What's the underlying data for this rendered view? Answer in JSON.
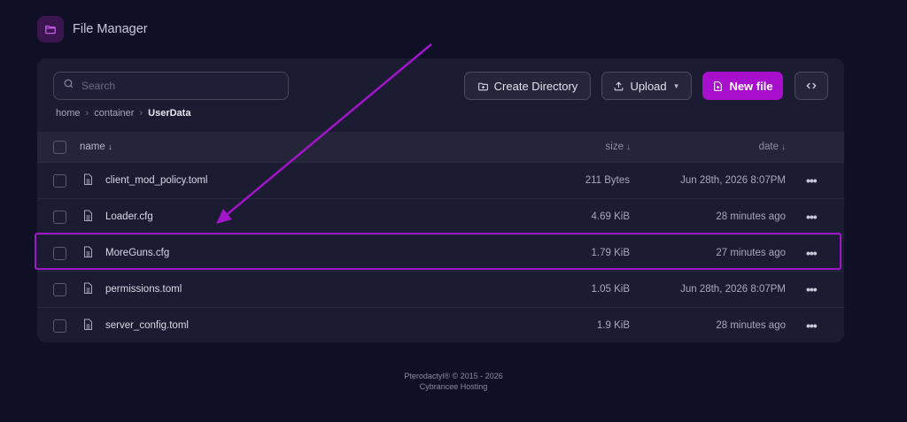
{
  "header": {
    "title": "File Manager",
    "icon": "folder-icon"
  },
  "search": {
    "placeholder": "Search"
  },
  "breadcrumb": {
    "items": [
      "home",
      "container"
    ],
    "current": "UserData"
  },
  "toolbar": {
    "create_label": "Create Directory",
    "upload_label": "Upload",
    "new_label": "New file",
    "accent": "#a80fcc"
  },
  "table": {
    "headers": {
      "name": "name",
      "size": "size",
      "date": "date"
    },
    "rows": [
      {
        "name": "client_mod_policy.toml",
        "size": "211 Bytes",
        "date": "Jun 28th, 2026 8:07PM"
      },
      {
        "name": "Loader.cfg",
        "size": "4.69 KiB",
        "date": "28 minutes ago"
      },
      {
        "name": "MoreGuns.cfg",
        "size": "1.79 KiB",
        "date": "27 minutes ago"
      },
      {
        "name": "permissions.toml",
        "size": "1.05 KiB",
        "date": "Jun 28th, 2026 8:07PM"
      },
      {
        "name": "server_config.toml",
        "size": "1.9 KiB",
        "date": "28 minutes ago"
      }
    ]
  },
  "footer": {
    "line1": "Pterodactyl® © 2015 - 2026",
    "line2": "Cybrancee Hosting"
  }
}
